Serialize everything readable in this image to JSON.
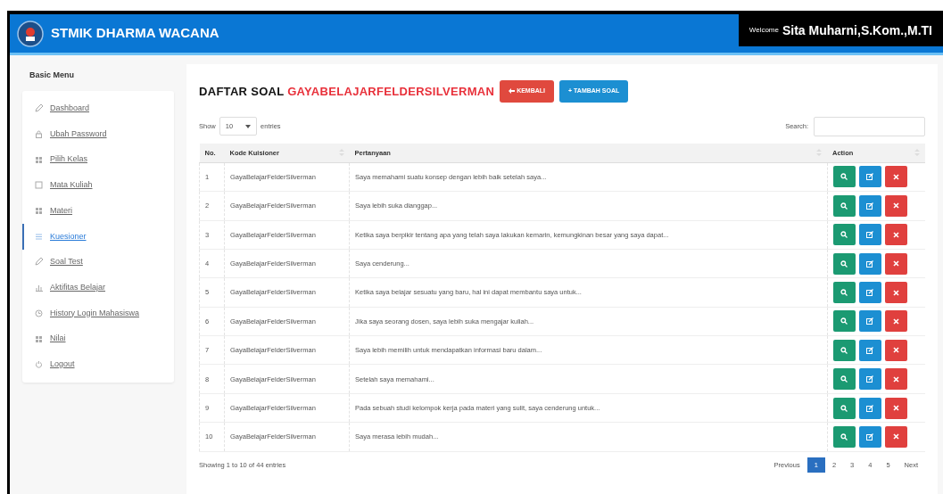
{
  "header": {
    "brand": "STMIK DHARMA WACANA",
    "welcome": "Welcome",
    "user": "Sita Muharni,S.Kom.,M.TI"
  },
  "sidebar": {
    "title": "Basic Menu",
    "items": [
      {
        "label": "Dashboard",
        "selected": false
      },
      {
        "label": "Ubah Password",
        "selected": false
      },
      {
        "label": "Pilih Kelas",
        "selected": false
      },
      {
        "label": "Mata Kuliah",
        "selected": false
      },
      {
        "label": "Materi",
        "selected": false
      },
      {
        "label": "Kuesioner",
        "selected": true
      },
      {
        "label": "Soal Test",
        "selected": false
      },
      {
        "label": "Aktifitas Belajar",
        "selected": false
      },
      {
        "label": "History Login Mahasiswa",
        "selected": false
      },
      {
        "label": "Nilai",
        "selected": false
      },
      {
        "label": "Logout",
        "selected": false
      }
    ]
  },
  "page": {
    "title": "DAFTAR SOAL",
    "subject": "GAYABELAJARFELDERSILVERMAN",
    "buttons": [
      {
        "label": "KEMBALI",
        "kind": "back"
      },
      {
        "label": "+ TAMBAH SOAL",
        "kind": "add"
      }
    ]
  },
  "table_controls": {
    "show": "Show",
    "length": "10",
    "entries": "entries",
    "search": "Search:"
  },
  "table": {
    "columns": [
      "No.",
      "Kode Kuisioner",
      "Pertanyaan",
      "Action"
    ],
    "rows": [
      {
        "no": "1",
        "code": "GayaBelajarFelderSilverman",
        "question": "Saya memahami suatu konsep dengan lebih baik setelah saya..."
      },
      {
        "no": "2",
        "code": "GayaBelajarFelderSilverman",
        "question": "Saya lebih suka dianggap..."
      },
      {
        "no": "3",
        "code": "GayaBelajarFelderSilverman",
        "question": "Ketika saya berpikir tentang apa yang telah saya lakukan kemarin, kemungkinan besar yang saya dapat..."
      },
      {
        "no": "4",
        "code": "GayaBelajarFelderSilverman",
        "question": "Saya cenderung..."
      },
      {
        "no": "5",
        "code": "GayaBelajarFelderSilverman",
        "question": "Ketika saya belajar sesuatu yang baru, hal ini dapat membantu saya untuk..."
      },
      {
        "no": "6",
        "code": "GayaBelajarFelderSilverman",
        "question": "Jika saya seorang dosen, saya lebih suka mengajar kuliah..."
      },
      {
        "no": "7",
        "code": "GayaBelajarFelderSilverman",
        "question": "Saya lebih memilih untuk mendapatkan informasi baru dalam..."
      },
      {
        "no": "8",
        "code": "GayaBelajarFelderSilverman",
        "question": "Setelah saya memahami..."
      },
      {
        "no": "9",
        "code": "GayaBelajarFelderSilverman",
        "question": "Pada sebuah studi kelompok kerja pada materi yang sulit, saya cenderung untuk..."
      },
      {
        "no": "10",
        "code": "GayaBelajarFelderSilverman",
        "question": "Saya merasa lebih mudah..."
      }
    ]
  },
  "footer": {
    "info": "Showing 1 to 10 of 44 entries",
    "pages": [
      {
        "label": "Previous",
        "selected": false
      },
      {
        "label": "1",
        "selected": true
      },
      {
        "label": "2",
        "selected": false
      },
      {
        "label": "3",
        "selected": false
      },
      {
        "label": "4",
        "selected": false
      },
      {
        "label": "5",
        "selected": false
      },
      {
        "label": "Next",
        "selected": false
      }
    ]
  }
}
